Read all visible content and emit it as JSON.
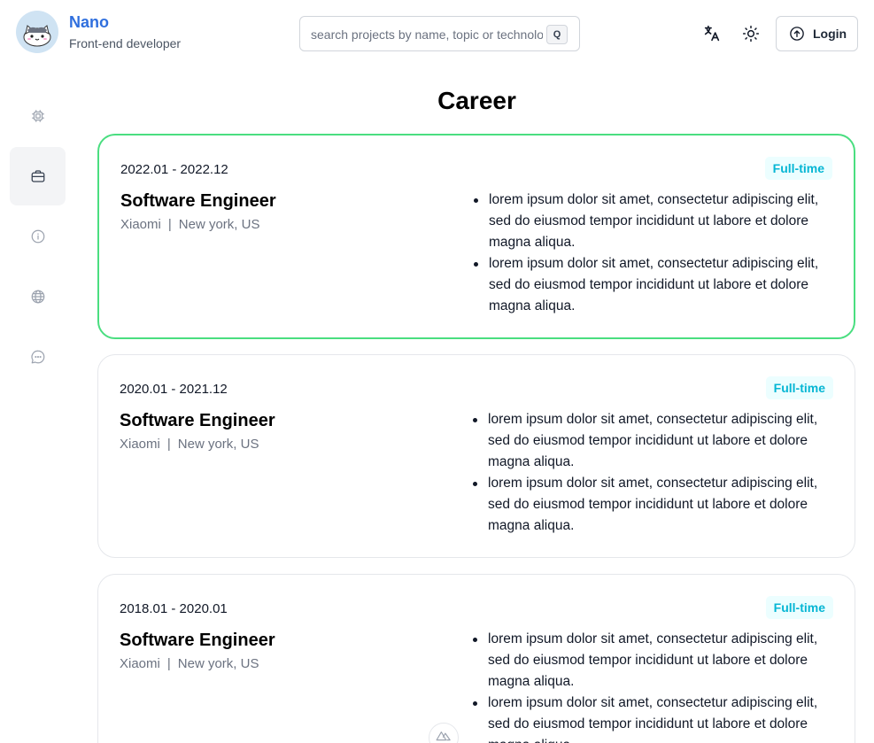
{
  "header": {
    "name": "Nano",
    "role": "Front-end developer",
    "search_placeholder": "search projects by name, topic or technology",
    "search_shortcut": "Q",
    "login_label": "Login"
  },
  "sidebar": {
    "items": [
      {
        "icon": "chip-icon"
      },
      {
        "icon": "briefcase-icon",
        "active": true
      },
      {
        "icon": "info-icon"
      },
      {
        "icon": "globe-icon"
      },
      {
        "icon": "chat-icon"
      }
    ]
  },
  "main": {
    "title": "Career",
    "jobs": [
      {
        "date": "2022.01 - 2022.12",
        "title": "Software Engineer",
        "company": "Xiaomi",
        "separator": "|",
        "location": "New york, US",
        "type": "Full-time",
        "bullets": [
          "lorem ipsum dolor sit amet, consectetur adipiscing elit, sed do eiusmod tempor incididunt ut labore et dolore magna aliqua.",
          "lorem ipsum dolor sit amet, consectetur adipiscing elit, sed do eiusmod tempor incididunt ut labore et dolore magna aliqua."
        ]
      },
      {
        "date": "2020.01 - 2021.12",
        "title": "Software Engineer",
        "company": "Xiaomi",
        "separator": "|",
        "location": "New york, US",
        "type": "Full-time",
        "bullets": [
          "lorem ipsum dolor sit amet, consectetur adipiscing elit, sed do eiusmod tempor incididunt ut labore et dolore magna aliqua.",
          "lorem ipsum dolor sit amet, consectetur adipiscing elit, sed do eiusmod tempor incididunt ut labore et dolore magna aliqua."
        ]
      },
      {
        "date": "2018.01 - 2020.01",
        "title": "Software Engineer",
        "company": "Xiaomi",
        "separator": "|",
        "location": "New york, US",
        "type": "Full-time",
        "bullets": [
          "lorem ipsum dolor sit amet, consectetur adipiscing elit, sed do eiusmod tempor incididunt ut labore et dolore magna aliqua.",
          "lorem ipsum dolor sit amet, consectetur adipiscing elit, sed do eiusmod tempor incididunt ut labore et dolore magna aliqua."
        ]
      }
    ]
  },
  "colors": {
    "brand": "#2f6fde",
    "active_card_border": "#4ade80",
    "badge_text": "#06b6d4",
    "badge_bg": "#ecfeff"
  }
}
